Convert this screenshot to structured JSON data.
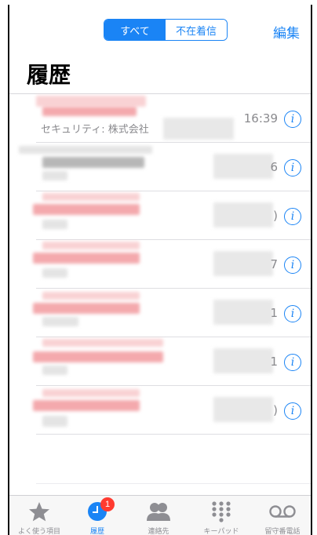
{
  "header": {
    "segments": [
      {
        "label": "すべて",
        "active": true
      },
      {
        "label": "不在着信",
        "active": false
      }
    ],
    "edit_label": "編集",
    "title": "履歴"
  },
  "calls": [
    {
      "contact_name": "",
      "name_color": "red",
      "subtitle": "セキュリティ: 株式会社",
      "time": "16:39"
    },
    {
      "contact_name": "",
      "name_color": "gray",
      "subtitle": "",
      "time": "6"
    },
    {
      "contact_name": "",
      "name_color": "red",
      "subtitle": "",
      "time": ")"
    },
    {
      "contact_name": "",
      "name_color": "red",
      "subtitle": "",
      "time": "7"
    },
    {
      "contact_name": "",
      "name_color": "red",
      "subtitle": "",
      "time": "1"
    },
    {
      "contact_name": "",
      "name_color": "red",
      "subtitle": "",
      "time": "1"
    },
    {
      "contact_name": "",
      "name_color": "red",
      "subtitle": "",
      "time": ")"
    }
  ],
  "info_glyph": "i",
  "tabbar": {
    "tabs": [
      {
        "label": "よく使う項目",
        "icon": "star-icon",
        "active": false
      },
      {
        "label": "履歴",
        "icon": "clock-icon",
        "active": true,
        "badge": "1"
      },
      {
        "label": "連絡先",
        "icon": "contacts-icon",
        "active": false
      },
      {
        "label": "キーパッド",
        "icon": "keypad-icon",
        "active": false
      },
      {
        "label": "留守番電話",
        "icon": "voicemail-icon",
        "active": false
      }
    ]
  },
  "colors": {
    "accent": "#1a84f5",
    "badge": "#ff3b30",
    "secondary_text": "#8a8a8e"
  }
}
